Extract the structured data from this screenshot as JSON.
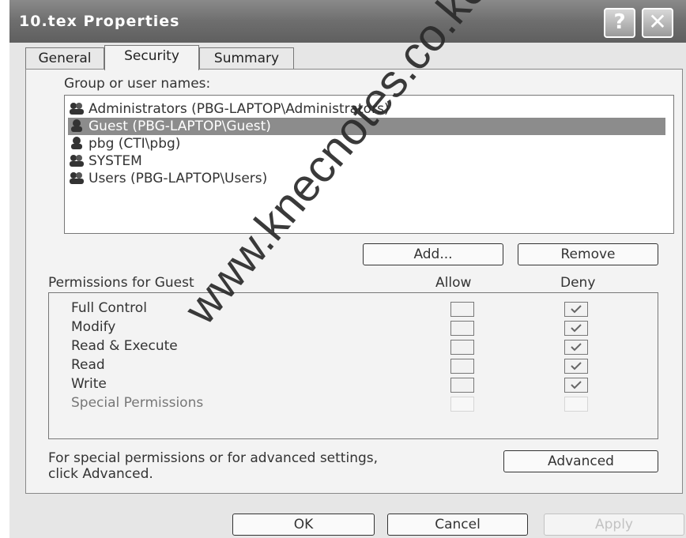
{
  "window": {
    "title": "10.tex Properties",
    "help_label": "?",
    "close_label": "✕"
  },
  "tabs": [
    {
      "label": "General",
      "active": false
    },
    {
      "label": "Security",
      "active": true
    },
    {
      "label": "Summary",
      "active": false
    }
  ],
  "security": {
    "group_label": "Group or user names:",
    "users": [
      {
        "name": "Administrators (PBG-LAPTOP\\Administrators)",
        "icon": "group-icon",
        "selected": false
      },
      {
        "name": "Guest (PBG-LAPTOP\\Guest)",
        "icon": "user-icon",
        "selected": true
      },
      {
        "name": "pbg (CTI\\pbg)",
        "icon": "user-icon",
        "selected": false
      },
      {
        "name": "SYSTEM",
        "icon": "group-icon",
        "selected": false
      },
      {
        "name": "Users (PBG-LAPTOP\\Users)",
        "icon": "group-icon",
        "selected": false
      }
    ],
    "add_label": "Add...",
    "remove_label": "Remove",
    "permissions_header": "Permissions for Guest",
    "allow_header": "Allow",
    "deny_header": "Deny",
    "permissions": [
      {
        "name": "Full Control",
        "allow": false,
        "deny": true,
        "enabled": true
      },
      {
        "name": "Modify",
        "allow": false,
        "deny": true,
        "enabled": true
      },
      {
        "name": "Read & Execute",
        "allow": false,
        "deny": true,
        "enabled": true
      },
      {
        "name": "Read",
        "allow": false,
        "deny": true,
        "enabled": true
      },
      {
        "name": "Write",
        "allow": false,
        "deny": true,
        "enabled": true
      },
      {
        "name": "Special Permissions",
        "allow": false,
        "deny": false,
        "enabled": false
      }
    ],
    "advanced_note_line1": "For special permissions or for advanced settings,",
    "advanced_note_line2": "click Advanced.",
    "advanced_label": "Advanced"
  },
  "footer": {
    "ok_label": "OK",
    "cancel_label": "Cancel",
    "apply_label": "Apply"
  },
  "watermark": "www.knecnotes.co.ke"
}
